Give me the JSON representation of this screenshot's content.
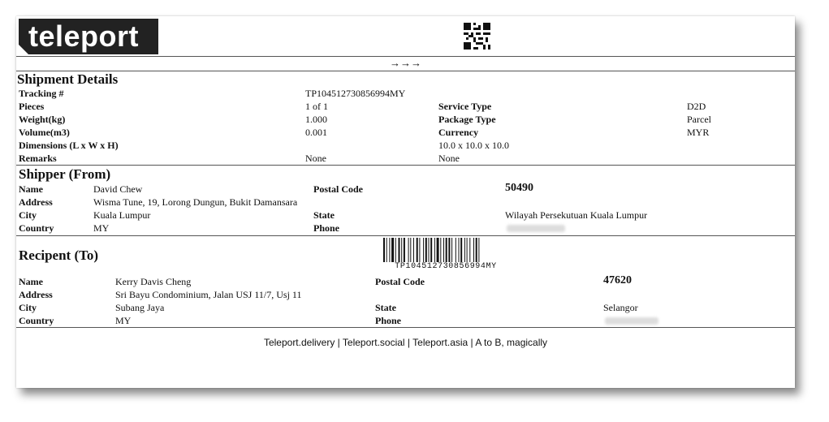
{
  "header": {
    "logo_text": "teleport",
    "arrows": "→→→"
  },
  "shipment": {
    "title": "Shipment Details",
    "tracking_label": "Tracking #",
    "tracking_value": "TP104512730856994MY",
    "pieces_label": "Pieces",
    "pieces_value": "1 of 1",
    "weight_label": "Weight(kg)",
    "weight_value": "1.000",
    "volume_label": "Volume(m3)",
    "volume_value": "0.001",
    "dimensions_label": "Dimensions (L x W x H)",
    "dimensions_value": "10.0 x 10.0 x 10.0",
    "remarks_label": "Remarks",
    "remarks_value": "None",
    "remarks_value2": "None",
    "service_type_label": "Service Type",
    "service_type_value": "D2D",
    "package_type_label": "Package Type",
    "package_type_value": "Parcel",
    "currency_label": "Currency",
    "currency_value": "MYR"
  },
  "shipper": {
    "title": "Shipper (From)",
    "name_label": "Name",
    "name_value": "David Chew",
    "address_label": "Address",
    "address_value": "Wisma Tune, 19, Lorong Dungun, Bukit Damansara",
    "city_label": "City",
    "city_value": "Kuala Lumpur",
    "country_label": "Country",
    "country_value": "MY",
    "postal_label": "Postal Code",
    "postal_value": "50490",
    "state_label": "State",
    "state_value": "Wilayah Persekutuan Kuala Lumpur",
    "phone_label": "Phone"
  },
  "barcode": {
    "text": "TP104512730856994MY"
  },
  "recipient": {
    "title": "Recipent (To)",
    "name_label": "Name",
    "name_value": "Kerry Davis Cheng",
    "address_label": "Address",
    "address_value": "Sri Bayu Condominium, Jalan USJ 11/7, Usj 11",
    "city_label": "City",
    "city_value": "Subang Jaya",
    "country_label": "Country",
    "country_value": "MY",
    "postal_label": "Postal Code",
    "postal_value": "47620",
    "state_label": "State",
    "state_value": "Selangor",
    "phone_label": "Phone"
  },
  "footer": {
    "text": "Teleport.delivery | Teleport.social | Teleport.asia | A to B, magically"
  }
}
